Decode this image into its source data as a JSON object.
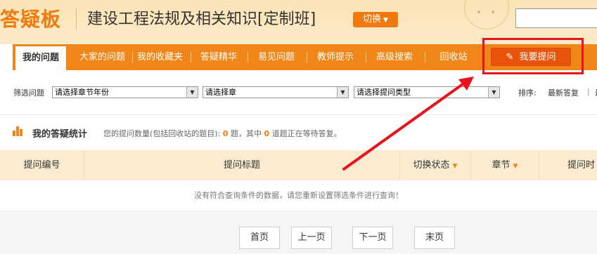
{
  "header": {
    "logo": "答疑板",
    "course_title": "建设工程法规及相关知识[定制班]",
    "switch_label": "切换"
  },
  "nav": {
    "tabs": [
      "我的问题",
      "大家的问题",
      "我的收藏夹",
      "答疑精华",
      "易见问题",
      "教师提示",
      "高级搜索",
      "回收站"
    ],
    "active": "我的问题",
    "ask_button": "我要提问"
  },
  "filter": {
    "label": "筛选问题",
    "selects": [
      "请选择章节年份",
      "请选择章",
      "请选择提问类型"
    ],
    "sort_label": "排序:",
    "sort_latest": "最新答复",
    "sort_separator": "|",
    "sort_next": "最"
  },
  "stats": {
    "title": "我的答疑统计",
    "desc_prefix": "您的提问数量(包括回收站的题目):",
    "total": "0",
    "desc_middle": "题，其中",
    "waiting": "0",
    "desc_suffix": "道题正在等待答复。"
  },
  "table": {
    "columns": [
      "提问编号",
      "提问标题",
      "切换状态",
      "章节",
      "提问时"
    ],
    "empty_message": "没有符合查询条件的数据，请您重新设置筛选条件进行查询！"
  },
  "pager": {
    "first": "首页",
    "prev": "上一页",
    "next": "下一页",
    "last": "末页"
  },
  "colors": {
    "brand_orange": "#f08617",
    "ask_button": "#e9540c",
    "highlight": "#e8141d",
    "header_bg": "#fbe3b6",
    "table_header_bg": "#fbebd0"
  }
}
